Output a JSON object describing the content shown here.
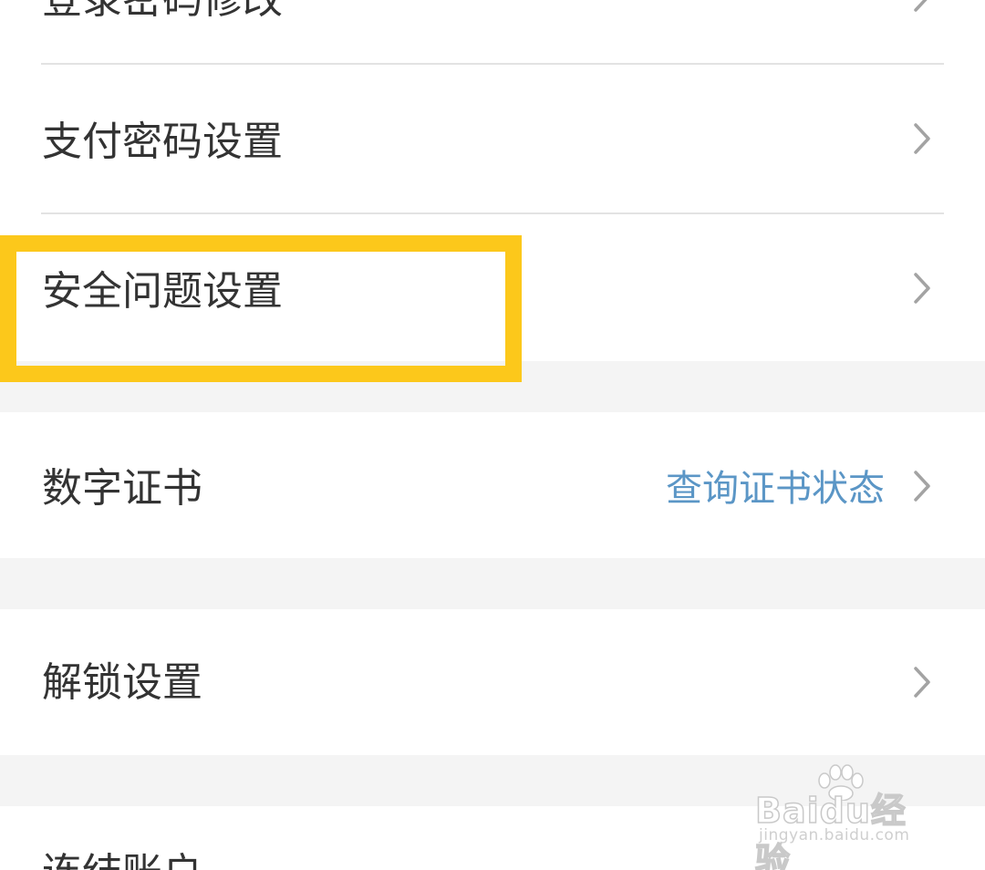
{
  "settings": {
    "items": [
      {
        "label": "登录密码修改"
      },
      {
        "label": "支付密码设置"
      },
      {
        "label": "安全问题设置"
      },
      {
        "label": "数字证书",
        "value": "查询证书状态"
      },
      {
        "label": "解锁设置"
      },
      {
        "label": "连结账户"
      }
    ]
  },
  "colors": {
    "highlight": "#fcc81b",
    "link": "#5b96c6",
    "text": "#333333",
    "background": "#f4f4f4"
  },
  "watermark": {
    "logo_text": "Baidu经验",
    "url": "jingyan.baidu.com"
  }
}
